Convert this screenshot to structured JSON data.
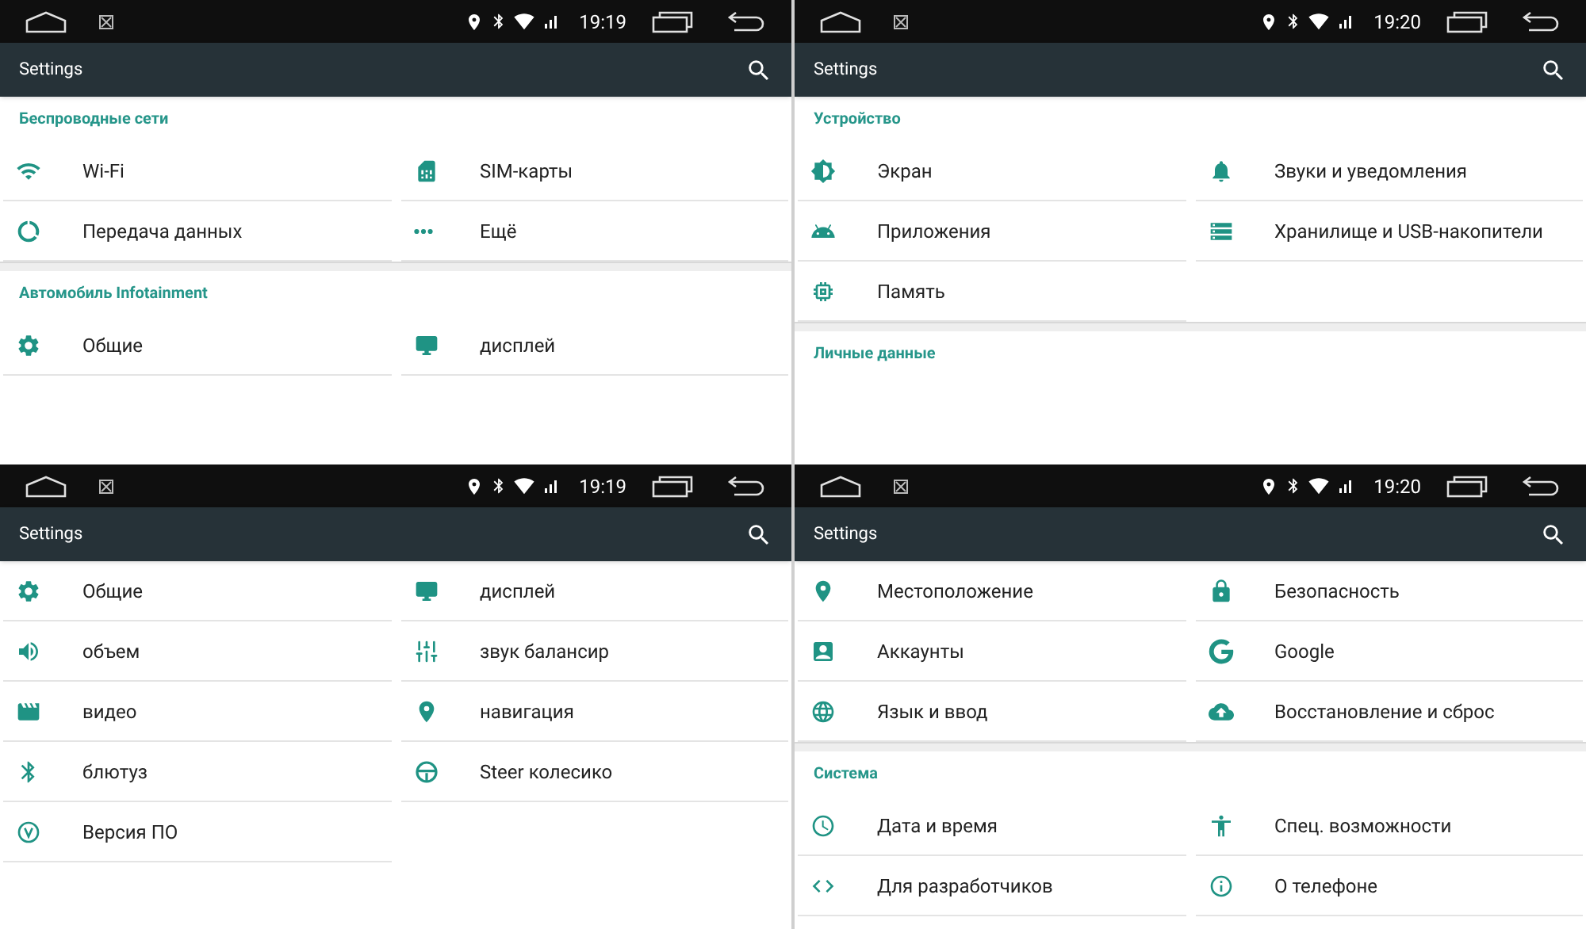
{
  "panels": [
    {
      "status_bar": {
        "time": "19:19"
      },
      "app_bar": {
        "title": "Settings"
      },
      "content": [
        {
          "kind": "header",
          "title": "Беспроводные сети"
        },
        {
          "kind": "row",
          "items": [
            {
              "label": "Wi-Fi"
            },
            {
              "label": "SIM-карты"
            }
          ]
        },
        {
          "kind": "row",
          "items": [
            {
              "label": "Передача данных"
            },
            {
              "label": "Ещё"
            }
          ]
        },
        {
          "kind": "gap"
        },
        {
          "kind": "header",
          "title": "Автомобиль Infotainment"
        },
        {
          "kind": "row",
          "items": [
            {
              "label": "Общие"
            },
            {
              "label": "дисплей"
            }
          ]
        }
      ]
    },
    {
      "status_bar": {
        "time": "19:20"
      },
      "app_bar": {
        "title": "Settings"
      },
      "content": [
        {
          "kind": "header",
          "title": "Устройство"
        },
        {
          "kind": "row",
          "items": [
            {
              "label": "Экран"
            },
            {
              "label": "Звуки и уведомления"
            }
          ]
        },
        {
          "kind": "row",
          "items": [
            {
              "label": "Приложения"
            },
            {
              "label": "Хранилище и USB-накопители"
            }
          ]
        },
        {
          "kind": "row",
          "items": [
            {
              "label": "Память"
            }
          ]
        },
        {
          "kind": "gap"
        },
        {
          "kind": "header",
          "title": "Личные данные"
        }
      ]
    },
    {
      "status_bar": {
        "time": "19:19"
      },
      "app_bar": {
        "title": "Settings"
      },
      "content": [
        {
          "kind": "row",
          "items": [
            {
              "label": "Общие"
            },
            {
              "label": "дисплей"
            }
          ]
        },
        {
          "kind": "row",
          "items": [
            {
              "label": "объем"
            },
            {
              "label": "звук балансир"
            }
          ]
        },
        {
          "kind": "row",
          "items": [
            {
              "label": "видео"
            },
            {
              "label": "навигация"
            }
          ]
        },
        {
          "kind": "row",
          "items": [
            {
              "label": "блютуз"
            },
            {
              "label": "Steer колесико"
            }
          ]
        },
        {
          "kind": "row",
          "items": [
            {
              "label": "Версия ПО"
            }
          ]
        }
      ]
    },
    {
      "status_bar": {
        "time": "19:20"
      },
      "app_bar": {
        "title": "Settings"
      },
      "content": [
        {
          "kind": "row",
          "items": [
            {
              "label": "Местоположение"
            },
            {
              "label": "Безопасность"
            }
          ]
        },
        {
          "kind": "row",
          "items": [
            {
              "label": "Аккаунты"
            },
            {
              "label": "Google"
            }
          ]
        },
        {
          "kind": "row",
          "items": [
            {
              "label": "Язык и ввод"
            },
            {
              "label": "Восстановление и сброс"
            }
          ]
        },
        {
          "kind": "gap"
        },
        {
          "kind": "header",
          "title": "Система"
        },
        {
          "kind": "row",
          "items": [
            {
              "label": "Дата и время"
            },
            {
              "label": "Спец. возможности"
            }
          ]
        },
        {
          "kind": "row",
          "items": [
            {
              "label": "Для разработчиков"
            },
            {
              "label": "О телефоне"
            }
          ]
        }
      ]
    }
  ]
}
